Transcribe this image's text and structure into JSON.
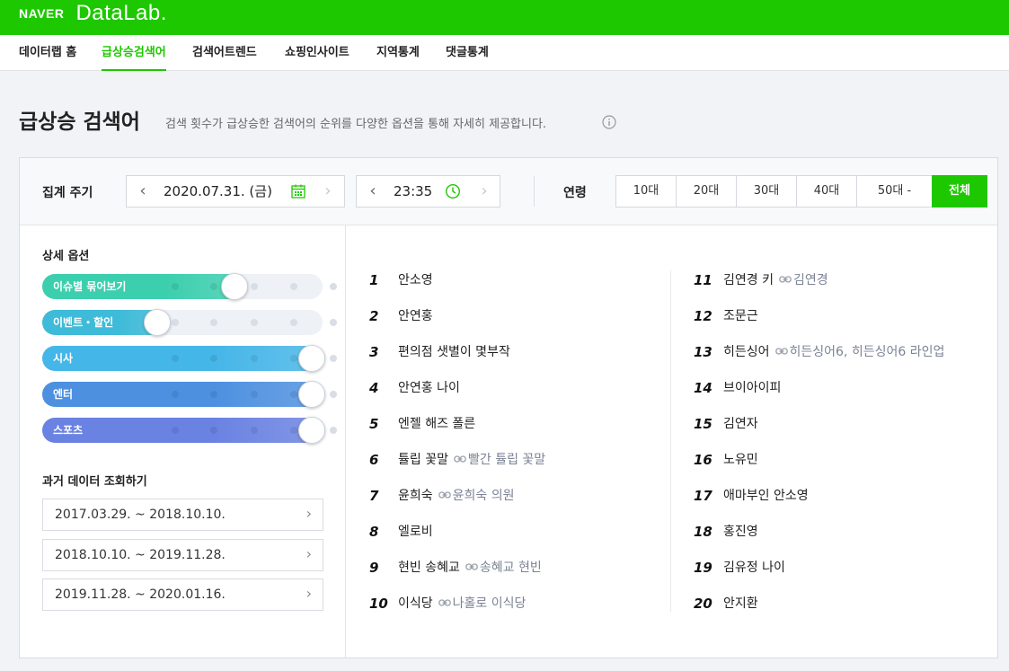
{
  "header": {
    "brand_naver": "NAVER",
    "brand_datalab": "DataLab."
  },
  "nav": {
    "items": [
      {
        "label": "데이터랩 홈",
        "active": false
      },
      {
        "label": "급상승검색어",
        "active": true
      },
      {
        "label": "검색어트렌드",
        "active": false
      },
      {
        "label": "쇼핑인사이트",
        "active": false
      },
      {
        "label": "지역통계",
        "active": false
      },
      {
        "label": "댓글통계",
        "active": false
      }
    ]
  },
  "page": {
    "title": "급상승 검색어",
    "description": "검색 횟수가 급상승한 검색어의 순위를 다양한 옵션을 통해 자세히 제공합니다."
  },
  "filters": {
    "period_label": "집계 주기",
    "date_value": "2020.07.31. (금)",
    "time_value": "23:35",
    "age_label": "연령",
    "age_options": [
      "10대",
      "20대",
      "30대",
      "40대",
      "50대 -",
      "전체"
    ],
    "age_selected": "전체"
  },
  "options": {
    "title": "상세 옵션",
    "sliders": [
      {
        "label": "이슈별 묶어보기",
        "level": 2,
        "color": "#3ccfae"
      },
      {
        "label": "이벤트・할인",
        "level": 0,
        "color": "#3ebbd8"
      },
      {
        "label": "시사",
        "level": 4,
        "color": "#45b6e8"
      },
      {
        "label": "엔터",
        "level": 4,
        "color": "#4d90e0"
      },
      {
        "label": "스포츠",
        "level": 4,
        "color": "#6a82e2"
      }
    ]
  },
  "past": {
    "title": "과거 데이터 조회하기",
    "ranges": [
      "2017.03.29. ~ 2018.10.10.",
      "2018.10.10. ~ 2019.11.28.",
      "2019.11.28. ~ 2020.01.16."
    ]
  },
  "rankings": [
    {
      "rank": "1",
      "keyword": "안소영",
      "related": ""
    },
    {
      "rank": "2",
      "keyword": "안연홍",
      "related": ""
    },
    {
      "rank": "3",
      "keyword": "편의점 샛별이 몇부작",
      "related": ""
    },
    {
      "rank": "4",
      "keyword": "안연홍 나이",
      "related": ""
    },
    {
      "rank": "5",
      "keyword": "엔젤 해즈 폴른",
      "related": ""
    },
    {
      "rank": "6",
      "keyword": "튤립 꽃말",
      "related": "빨간 튤립 꽃말"
    },
    {
      "rank": "7",
      "keyword": "윤희숙",
      "related": "윤희숙 의원"
    },
    {
      "rank": "8",
      "keyword": "엘로비",
      "related": ""
    },
    {
      "rank": "9",
      "keyword": "현빈 송혜교",
      "related": "송혜교 현빈"
    },
    {
      "rank": "10",
      "keyword": "이식당",
      "related": "나홀로 이식당"
    },
    {
      "rank": "11",
      "keyword": "김연경 키",
      "related": "김연경"
    },
    {
      "rank": "12",
      "keyword": "조문근",
      "related": ""
    },
    {
      "rank": "13",
      "keyword": "히든싱어",
      "related": "히든싱어6, 히든싱어6 라인업"
    },
    {
      "rank": "14",
      "keyword": "브이아이피",
      "related": ""
    },
    {
      "rank": "15",
      "keyword": "김연자",
      "related": ""
    },
    {
      "rank": "16",
      "keyword": "노유민",
      "related": ""
    },
    {
      "rank": "17",
      "keyword": "애마부인 안소영",
      "related": ""
    },
    {
      "rank": "18",
      "keyword": "홍진영",
      "related": ""
    },
    {
      "rank": "19",
      "keyword": "김유정 나이",
      "related": ""
    },
    {
      "rank": "20",
      "keyword": "안지환",
      "related": ""
    }
  ],
  "icons": {
    "calendar": "calendar-icon",
    "clock": "clock-icon",
    "info": "info-icon",
    "link": "link-icon"
  },
  "colors": {
    "brand": "#1ec800"
  }
}
